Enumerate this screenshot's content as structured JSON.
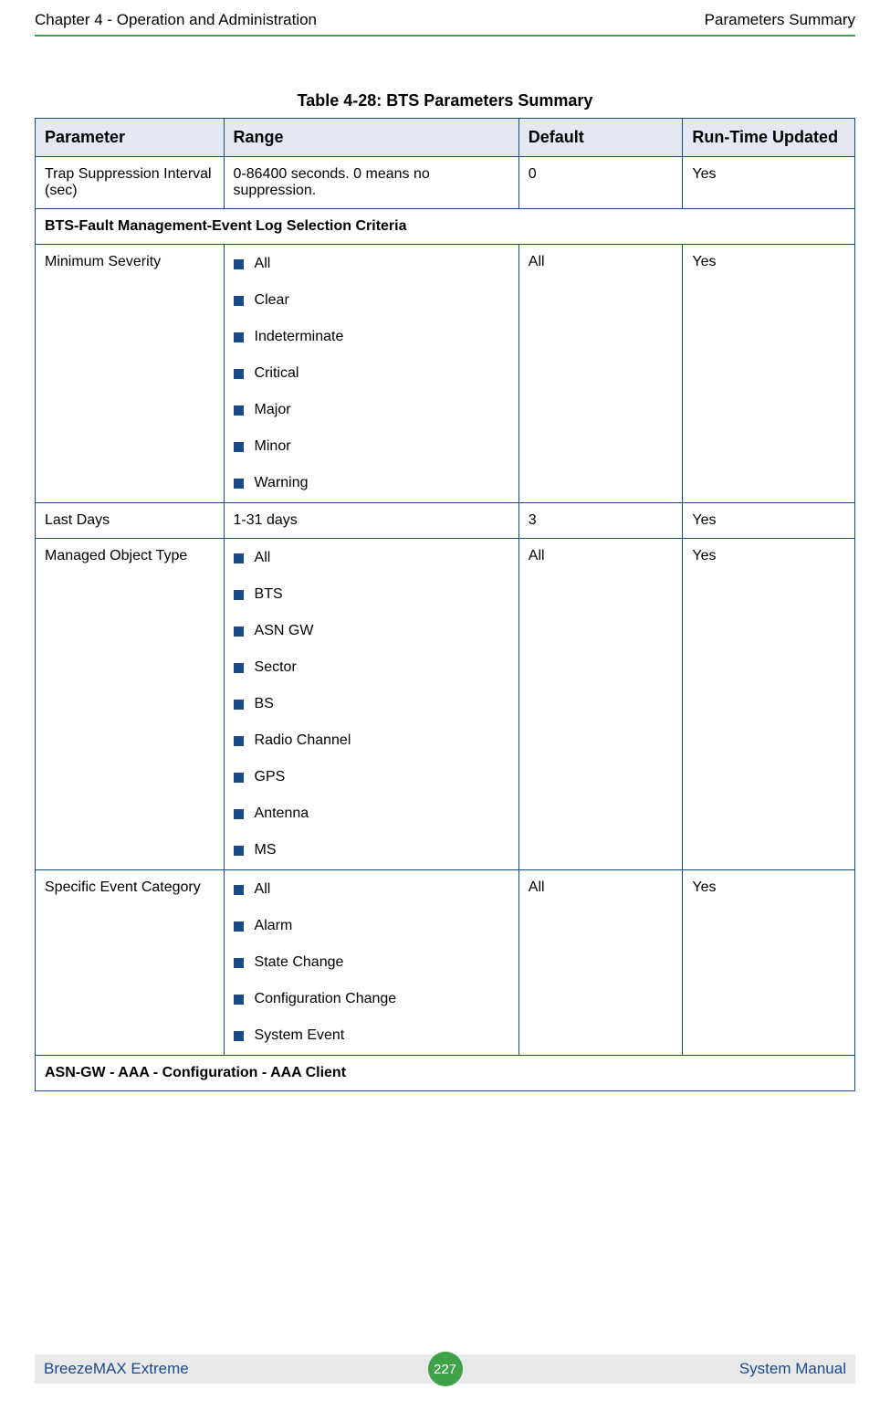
{
  "header": {
    "left": "Chapter 4 - Operation and Administration",
    "right": "Parameters Summary"
  },
  "table": {
    "title": "Table 4-28: BTS Parameters Summary",
    "columns": {
      "parameter": "Parameter",
      "range": "Range",
      "default": "Default",
      "runtime": "Run-Time Updated"
    },
    "rows": {
      "trap": {
        "param": "Trap Suppression Interval (sec)",
        "range": "0-86400 seconds. 0 means no suppression.",
        "default": "0",
        "runtime": "Yes"
      },
      "section_fault": "BTS-Fault Management-Event Log Selection Criteria",
      "min_severity": {
        "param": "Minimum Severity",
        "range": [
          "All",
          "Clear",
          "Indeterminate",
          "Critical",
          "Major",
          "Minor",
          "Warning"
        ],
        "default": "All",
        "runtime": "Yes"
      },
      "last_days": {
        "param": "Last Days",
        "range": "1-31 days",
        "default": "3",
        "runtime": "Yes"
      },
      "managed_object": {
        "param": "Managed Object Type",
        "range": [
          "All",
          "BTS",
          "ASN GW",
          "Sector",
          "BS",
          "Radio Channel",
          "GPS",
          "Antenna",
          "MS"
        ],
        "default": "All",
        "runtime": "Yes"
      },
      "specific_event": {
        "param": "Specific Event Category",
        "range": [
          "All",
          "Alarm",
          "State Change",
          "Configuration Change",
          "System Event"
        ],
        "default": "All",
        "runtime": "Yes"
      },
      "section_asn": "ASN-GW - AAA - Configuration - AAA Client"
    }
  },
  "footer": {
    "left": "BreezeMAX Extreme",
    "page": "227",
    "right": "System Manual"
  }
}
